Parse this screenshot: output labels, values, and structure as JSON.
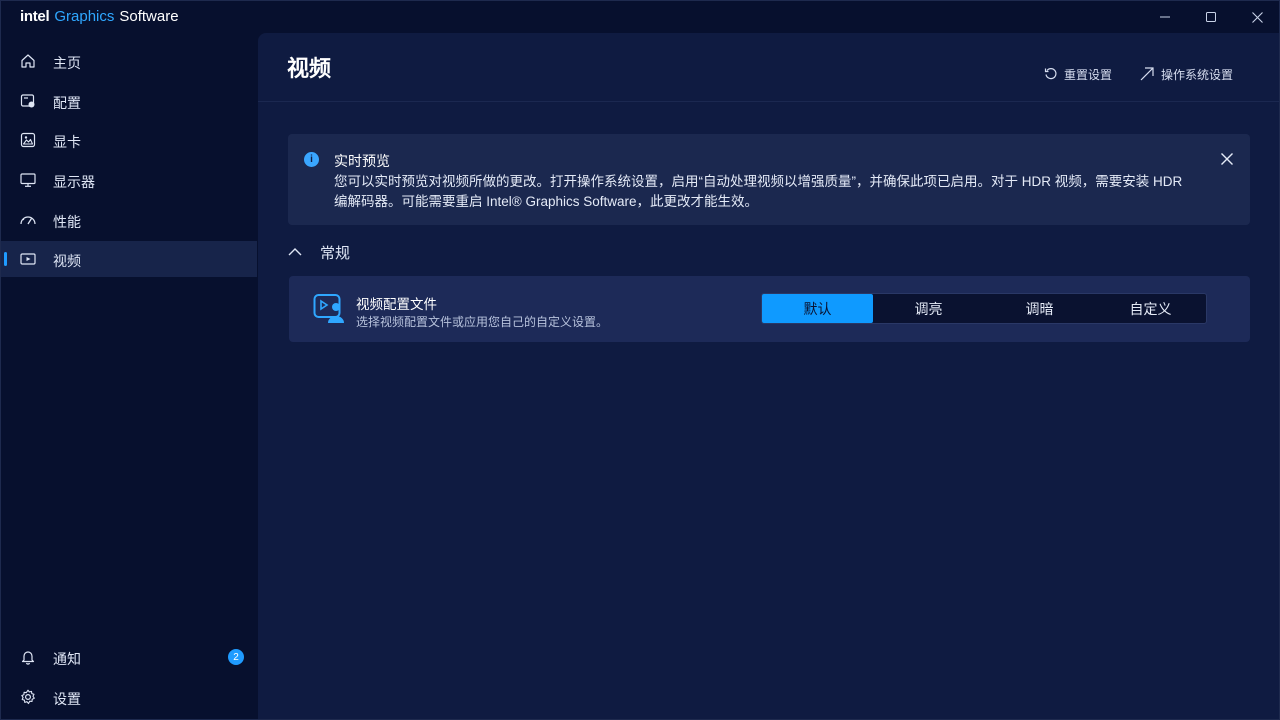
{
  "app": {
    "brand_intel": "intel",
    "brand_graphics": "Graphics",
    "brand_software": "Software"
  },
  "sidebar": {
    "items": [
      {
        "label": "主页",
        "icon": "home-icon"
      },
      {
        "label": "配置",
        "icon": "profile-config-icon"
      },
      {
        "label": "显卡",
        "icon": "graphics-card-icon"
      },
      {
        "label": "显示器",
        "icon": "monitor-icon"
      },
      {
        "label": "性能",
        "icon": "gauge-icon"
      },
      {
        "label": "视频",
        "icon": "video-icon",
        "active": true
      }
    ],
    "bottom_items": [
      {
        "label": "通知",
        "icon": "bell-icon",
        "badge": "2"
      },
      {
        "label": "设置",
        "icon": "gear-icon"
      }
    ]
  },
  "header": {
    "title": "视频",
    "reset_label": "重置设置",
    "os_settings_label": "操作系统设置"
  },
  "banner": {
    "title": "实时预览",
    "text": "您可以实时预览对视频所做的更改。打开操作系统设置，启用“自动处理视频以增强质量”，并确保此项已启用。对于 HDR 视频，需要安装 HDR 编解码器。可能需要重启 Intel® Graphics Software，此更改才能生效。"
  },
  "section": {
    "title": "常规"
  },
  "video_profile": {
    "title": "视频配置文件",
    "subtitle": "选择视频配置文件或应用您自己的自定义设置。",
    "options": [
      "默认",
      "调亮",
      "调暗",
      "自定义"
    ],
    "selected": "默认"
  },
  "colors": {
    "accent": "#0f9aff",
    "background": "#07102e",
    "panel": "#0f1b41",
    "card": "#1d2a58"
  }
}
